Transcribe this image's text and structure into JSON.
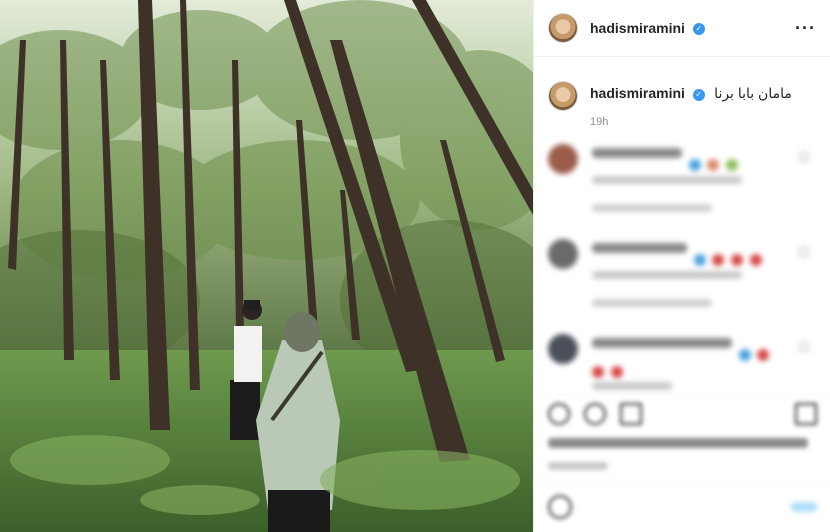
{
  "header": {
    "username": "hadismiramini",
    "more_icon": "more-horizontal-icon",
    "more_label": "···"
  },
  "caption": {
    "username": "hadismiramini",
    "text": "مامان بابا برنا",
    "timestamp": "19h"
  },
  "colors": {
    "verified": "#3897f0",
    "text": "#262626",
    "muted": "#8e8e8e",
    "border": "#efefef"
  },
  "icons": {
    "verified": "verified-badge-icon",
    "like": "heart-icon",
    "comment": "comment-icon",
    "share": "share-icon",
    "save": "bookmark-icon",
    "emoji": "emoji-icon"
  }
}
